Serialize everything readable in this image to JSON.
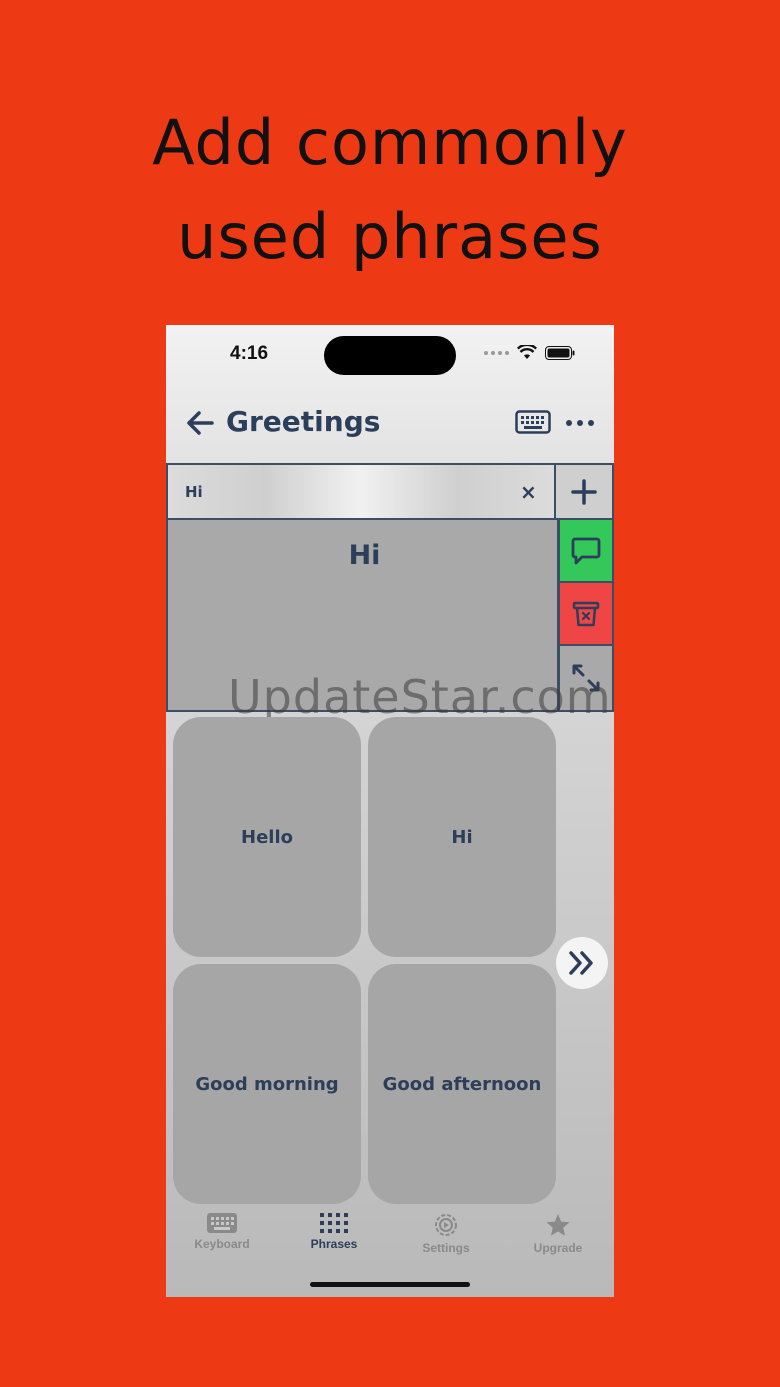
{
  "promo": {
    "line1": "Add commonly",
    "line2": "used phrases"
  },
  "status": {
    "time": "4:16"
  },
  "nav": {
    "title": "Greetings"
  },
  "input": {
    "value": "Hi",
    "clear": "×"
  },
  "preview": {
    "text": "Hi"
  },
  "watermark": "UpdateStar.com",
  "phrases": [
    "Hello",
    "Hi",
    "Good morning",
    "Good afternoon"
  ],
  "tabs": [
    {
      "label": "Keyboard",
      "icon": "keyboard-icon"
    },
    {
      "label": "Phrases",
      "icon": "grid-icon"
    },
    {
      "label": "Settings",
      "icon": "settings-icon"
    },
    {
      "label": "Upgrade",
      "icon": "star-icon"
    }
  ],
  "colors": {
    "background": "#ee3a14",
    "accent": "#2c3e5a",
    "speak": "#34c759",
    "delete": "#f04545"
  }
}
